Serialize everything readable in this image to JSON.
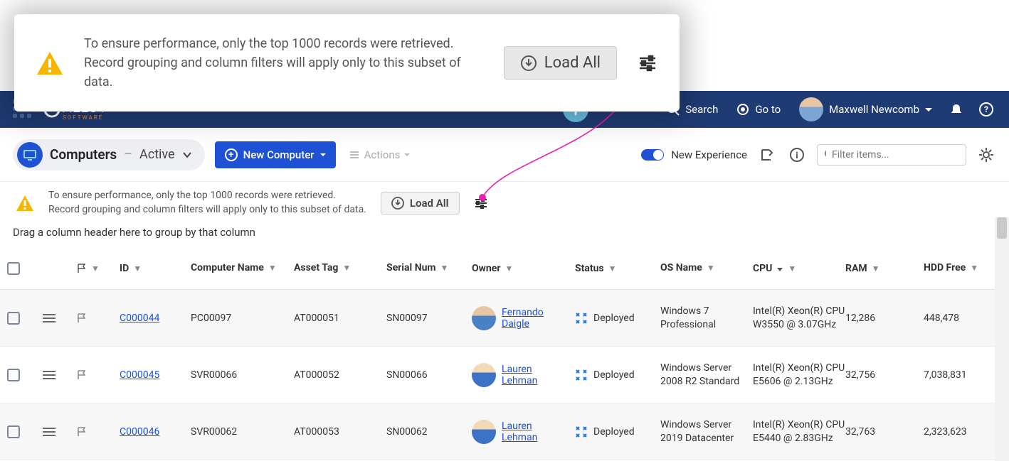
{
  "popup": {
    "line1": "To ensure performance, only the top 1000 records were retrieved.",
    "line2": "Record grouping and column filters will apply only to this subset of data.",
    "load_all": "Load All"
  },
  "navbar": {
    "search": "Search",
    "goto": "Go to",
    "user": "Maxwell Newcomb"
  },
  "toolbar": {
    "title": "Computers",
    "subtitle": "Active",
    "new_computer": "New Computer",
    "actions": "Actions",
    "new_experience": "New Experience",
    "filter_placeholder": "Filter items..."
  },
  "small_banner": {
    "line1": "To ensure performance, only the top 1000 records were retrieved.",
    "line2": "Record grouping and column filters will apply only to this subset of data.",
    "load_all": "Load All"
  },
  "group_hint": "Drag a column header here to group by that column",
  "columns": {
    "id": "ID",
    "cname": "Computer Name",
    "tag": "Asset Tag",
    "serial": "Serial Num",
    "owner": "Owner",
    "status": "Status",
    "os": "OS Name",
    "cpu": "CPU",
    "ram": "RAM",
    "hdd": "HDD Free"
  },
  "rows": [
    {
      "id": "C000044",
      "cname": "PC00097",
      "tag": "AT000051",
      "serial": "SN00097",
      "owner": "Fernando Daigle",
      "owner_first": "Fernando",
      "owner_last": "Daigle",
      "status": "Deployed",
      "os": "Windows 7 Professional",
      "cpu": "Intel(R) Xeon(R) CPU W3550 @ 3.07GHz",
      "ram": "12,286",
      "hdd": "448,478"
    },
    {
      "id": "C000045",
      "cname": "SVR00066",
      "tag": "AT000052",
      "serial": "SN00066",
      "owner": "Lauren Lehman",
      "owner_first": "Lauren",
      "owner_last": "Lehman",
      "status": "Deployed",
      "os": "Windows Server 2008 R2 Standard",
      "cpu": "Intel(R) Xeon(R) CPU E5606 @ 2.13GHz",
      "ram": "32,756",
      "hdd": "7,038,831"
    },
    {
      "id": "C000046",
      "cname": "SVR00062",
      "tag": "AT000053",
      "serial": "SN00062",
      "owner": "Lauren Lehman",
      "owner_first": "Lauren",
      "owner_last": "Lehman",
      "status": "Deployed",
      "os": "Windows Server 2019 Datacenter",
      "cpu": "Intel(R) Xeon(R) CPU E5440 @ 2.83GHz",
      "ram": "32,763",
      "hdd": "2,323,623"
    }
  ]
}
